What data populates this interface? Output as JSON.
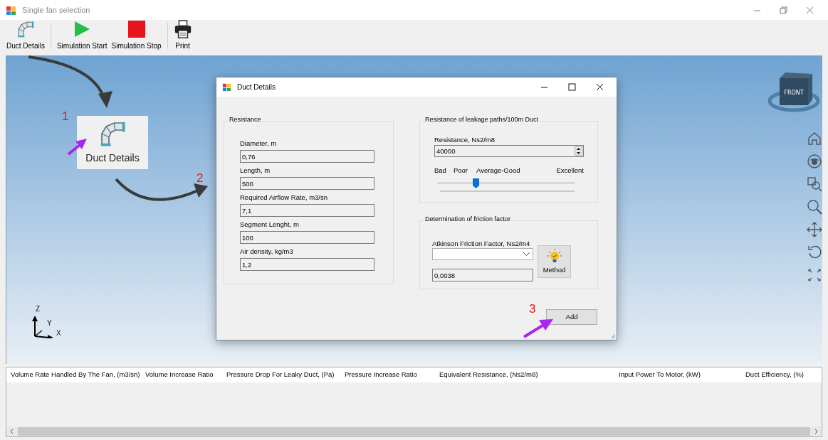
{
  "window": {
    "title": "Single fan selection"
  },
  "toolbar": [
    {
      "label": "Duct Details",
      "kind": "duct"
    },
    {
      "label": "Simulation Start",
      "kind": "play"
    },
    {
      "label": "Simulation Stop",
      "kind": "stop"
    },
    {
      "label": "Print",
      "kind": "print"
    }
  ],
  "viewport": {
    "callout": {
      "label": "Duct Details"
    },
    "annotations": [
      {
        "label": "1"
      },
      {
        "label": "2"
      },
      {
        "label": "3"
      }
    ],
    "view_cube": {
      "face": "FRONT"
    },
    "axes": [
      "Z",
      "Y",
      "X"
    ]
  },
  "dialog": {
    "title": "Duct Details",
    "resistance": {
      "title": "Resistance",
      "fields": [
        {
          "label": "Diameter,  m",
          "value": "0,76"
        },
        {
          "label": "Length, m",
          "value": "500"
        },
        {
          "label": "Required Airflow Rate,  m3/sn",
          "value": "7,1"
        },
        {
          "label": "Segment Lenght,  m",
          "value": "100"
        },
        {
          "label": "Air density, kg/m3",
          "value": "1,2"
        }
      ]
    },
    "leakage": {
      "title": "Resistance of leakage paths/100m Duct",
      "field_label": "Resistance, Ns2/m8",
      "value": "40000",
      "scale": [
        "Bad",
        "Poor",
        "Average-Good",
        "Excellent"
      ],
      "level": 0.28
    },
    "friction": {
      "title": "Determination of friction factor",
      "label": "Atkinson Friction Factor, Ns2/m4",
      "value": "0,0038",
      "method_button": "Method"
    },
    "add_button": "Add"
  },
  "table": {
    "columns": [
      "Volume Rate Handled By The Fan, (m3/sn)",
      "Volume Increase Ratio",
      "Pressure Drop For Leaky Duct, (Pa)",
      "Pressure Increase Ratio",
      "Equivalent Resistance, (Ns2/m8)",
      "Input Power To Motor, (kW)",
      "Duct Efficiency, (%)"
    ]
  }
}
